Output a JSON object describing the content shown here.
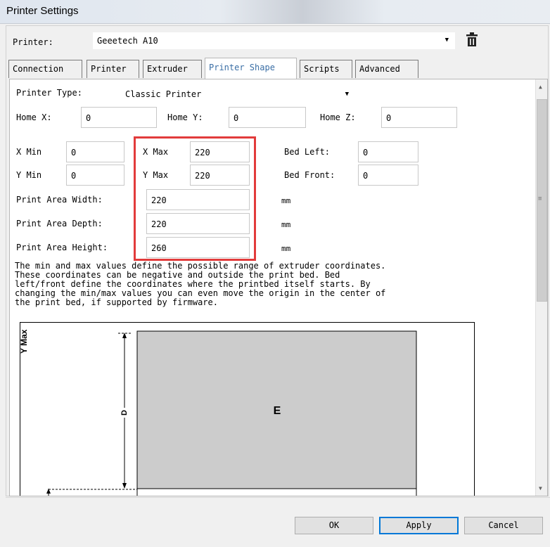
{
  "window": {
    "title": "Printer Settings"
  },
  "printer": {
    "label": "Printer:",
    "selected": "Geeetech A10"
  },
  "tabs": [
    {
      "label": "Connection"
    },
    {
      "label": "Printer"
    },
    {
      "label": "Extruder"
    },
    {
      "label": "Printer Shape",
      "active": true
    },
    {
      "label": "Scripts"
    },
    {
      "label": "Advanced"
    }
  ],
  "shape": {
    "printer_type_label": "Printer Type:",
    "printer_type_value": "Classic Printer",
    "home_x_label": "Home X:",
    "home_x": "0",
    "home_y_label": "Home Y:",
    "home_y": "0",
    "home_z_label": "Home Z:",
    "home_z": "0",
    "x_min_label": "X Min",
    "x_min": "0",
    "x_max_label": "X Max",
    "x_max": "220",
    "y_min_label": "Y Min",
    "y_min": "0",
    "y_max_label": "Y Max",
    "y_max": "220",
    "bed_left_label": "Bed Left:",
    "bed_left": "0",
    "bed_front_label": "Bed Front:",
    "bed_front": "0",
    "width_label": "Print Area Width:",
    "width": "220",
    "depth_label": "Print Area Depth:",
    "depth": "220",
    "height_label": "Print Area Height:",
    "height": "260",
    "unit": "mm",
    "description": [
      "The min and max values define the possible range of extruder coordinates.",
      "These coordinates can be negative and outside the print bed. Bed",
      "left/front define the coordinates where the printbed itself starts. By",
      "changing the min/max values you can even move the origin in the center of",
      "the print bed, if supported by firmware."
    ]
  },
  "diagram": {
    "y_axis_label": "Y Max",
    "dim_label": "D",
    "bed_label": "E"
  },
  "buttons": {
    "ok": "OK",
    "apply": "Apply",
    "cancel": "Cancel"
  },
  "colors": {
    "highlight": "#e23b3b",
    "active_tab_text": "#3a6ea5",
    "bed_fill": "#cccccc"
  }
}
